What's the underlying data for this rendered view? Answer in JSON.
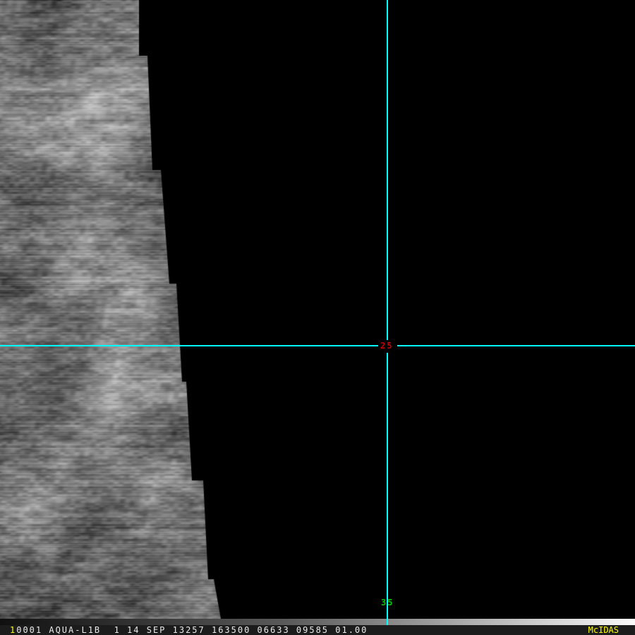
{
  "app": {
    "name": "McIDAS",
    "window_type": "satellite-image-display"
  },
  "status_bar": {
    "frame_indicator": "1",
    "info_text": "0001 AQUA-L1B  1 14 SEP 13257 163500 06633 09585 01.00",
    "fields": {
      "frame": "1",
      "frame_directory": "0001",
      "dataset": "AQUA-L1B",
      "band": "1",
      "date": "14 SEP 13257",
      "time": "163500",
      "line": "06633",
      "element": "09585",
      "magnification": "01.00"
    },
    "brand": "McIDAS"
  },
  "annotations": {
    "center_label": "25",
    "bottom_label": "35"
  },
  "colors": {
    "crosshair": "#00ffff",
    "center_label": "#c80000",
    "bottom_label": "#00cc00",
    "status_text": "#ececec",
    "highlight": "#ffff00",
    "background": "#000000"
  }
}
